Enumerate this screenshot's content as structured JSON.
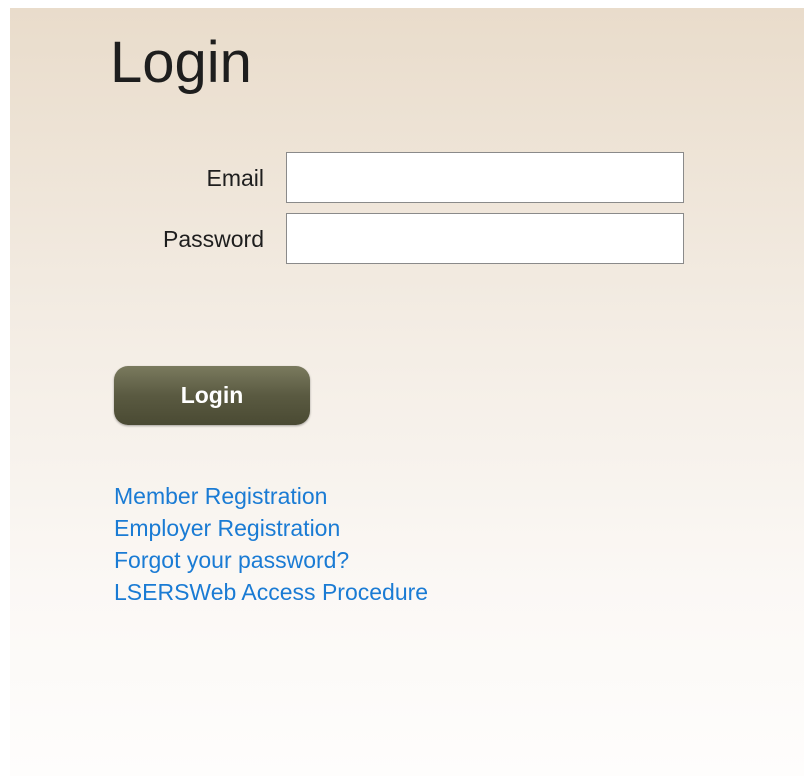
{
  "page": {
    "title": "Login"
  },
  "form": {
    "email_label": "Email",
    "email_value": "",
    "password_label": "Password",
    "password_value": "",
    "submit_label": "Login"
  },
  "links": [
    {
      "label": "Member Registration"
    },
    {
      "label": "Employer Registration"
    },
    {
      "label": "Forgot your password?"
    },
    {
      "label": "LSERSWeb Access Procedure"
    }
  ],
  "colors": {
    "link": "#1a7bd4",
    "button": "#5a5a41",
    "background_top": "#e9dccb",
    "background_bottom": "#fefdfc"
  }
}
